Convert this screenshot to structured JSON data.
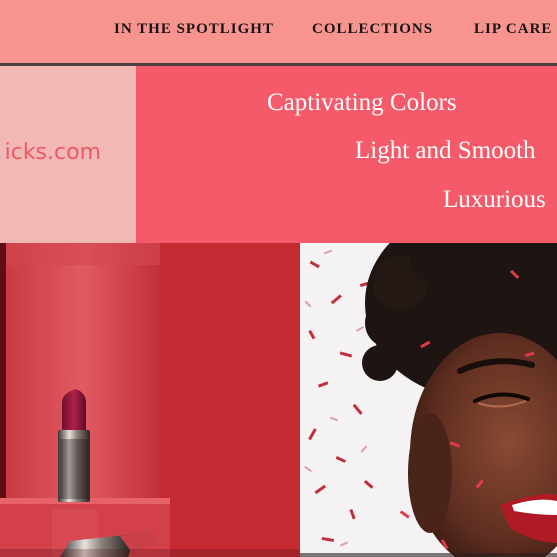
{
  "nav": {
    "items": [
      "IN THE SPOTLIGHT",
      "COLLECTIONS",
      "LIP CARE"
    ]
  },
  "logo": {
    "text": "icks.com"
  },
  "taglines": [
    "Captivating Colors",
    "Light and Smooth",
    "Luxurious"
  ],
  "colors": {
    "nav_bg": "#f79490",
    "logo_bg": "#f2b8b6",
    "tagline_bg": "#f45a69",
    "logo_text": "#ec5a63"
  },
  "images": {
    "left": "lipstick-product-photo",
    "right": "woman-smiling-with-confetti-photo"
  }
}
